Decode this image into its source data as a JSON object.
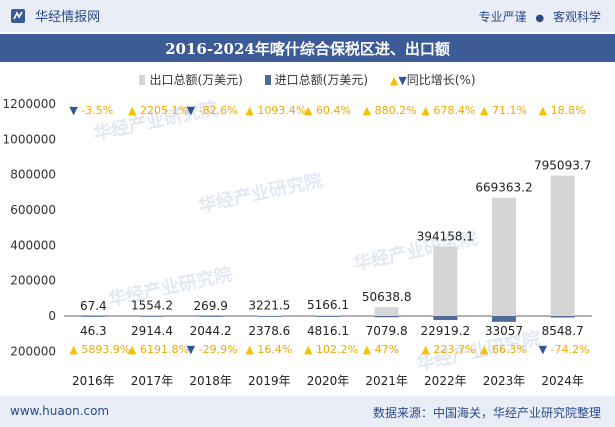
{
  "header": {
    "brand": "华经情报网",
    "tag1": "专业严谨",
    "tag2": "客观科学",
    "dot": "●"
  },
  "footer": {
    "left": "www.huaon.com",
    "right": "数据来源：中国海关，华经产业研究院整理"
  },
  "watermark": "华经产业研究院",
  "colors": {
    "export_bar": "#d6d6d6",
    "import_bar": "#4f6b9c",
    "up": "#f2c200",
    "down": "#2f5597",
    "growth_text": "#f0a800"
  },
  "chart_data": {
    "type": "bar",
    "title": "2016-2024年喀什综合保税区进、出口额",
    "categories": [
      "2016年",
      "2017年",
      "2018年",
      "2019年",
      "2020年",
      "2021年",
      "2022年",
      "2023年",
      "2024年"
    ],
    "series": [
      {
        "name": "出口总额(万美元)",
        "values": [
          67.4,
          1554.2,
          269.9,
          3221.5,
          5166.1,
          50638.8,
          394158.1,
          669363.2,
          795093.7
        ],
        "labels": [
          "67.4",
          "1554.2",
          "269.9",
          "3221.5",
          "5166.1",
          "50638.8",
          "394158.1",
          "669363.2",
          "795093.7"
        ],
        "growth": [
          "-3.5%",
          "2205.1%",
          "-82.6%",
          "1093.4%",
          "60.4%",
          "880.2%",
          "678.4%",
          "71.1%",
          "18.8%"
        ]
      },
      {
        "name": "进口总额(万美元)",
        "values": [
          46.3,
          2914.4,
          2044.2,
          2378.6,
          4816.1,
          7079.8,
          22919.2,
          33057,
          8548.7
        ],
        "labels": [
          "46.3",
          "2914.4",
          "2044.2",
          "2378.6",
          "4816.1",
          "7079.8",
          "22919.2",
          "33057",
          "8548.7"
        ],
        "growth": [
          "5893.9%",
          "6191.8%",
          "-29.9%",
          "16.4%",
          "102.2%",
          "47%",
          "223.7%",
          "66.3%",
          "-74.2%"
        ]
      }
    ],
    "legend": [
      "出口总额(万美元)",
      "进口总额(万美元)",
      "同比增长(%)"
    ],
    "yticks": [
      "1200000",
      "1000000",
      "800000",
      "600000",
      "400000",
      "200000",
      "0",
      "200000"
    ],
    "ylim": [
      -200000,
      1200000
    ],
    "note": "import values are plotted as negative (below zero line)"
  }
}
